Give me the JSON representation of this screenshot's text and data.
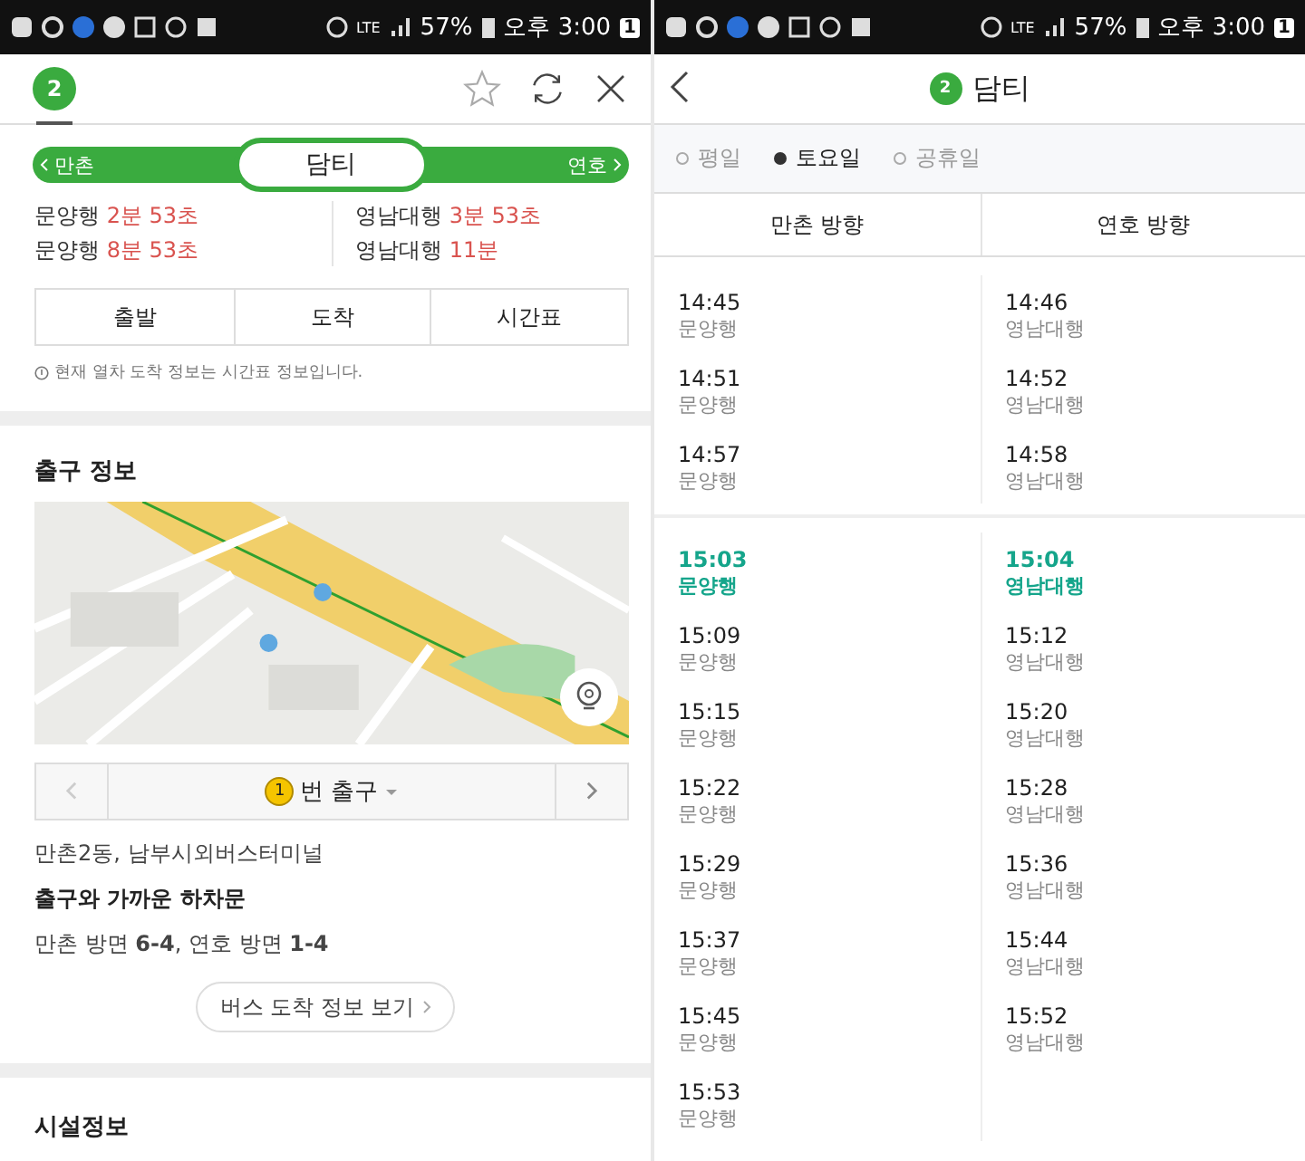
{
  "status_bars": [
    {
      "network": "LTE",
      "battery": "57%",
      "time": "오후 3:00",
      "notification_count": "1"
    },
    {
      "network": "LTE",
      "battery": "57%",
      "time": "오후 3:00",
      "notification_count": "1"
    }
  ],
  "station_panel": {
    "line_badge": "2",
    "station_bar": {
      "previous": "만촌",
      "current": "담티",
      "next": "연호"
    },
    "arrivals": [
      [
        {
          "destination": "문양행",
          "time": "2분 53초"
        },
        {
          "destination": "문양행",
          "time": "8분 53초"
        }
      ],
      [
        {
          "destination": "영남대행",
          "time": "3분 53초"
        },
        {
          "destination": "영남대행",
          "time": "11분"
        }
      ]
    ],
    "buttons": [
      "출발",
      "도착",
      "시간표"
    ],
    "notice": "현재 열차 도착 정보는 시간표 정보입니다.",
    "exit_info": {
      "title": "출구 정보",
      "exit_number": "1",
      "exit_label": "번 출구",
      "address": "만촌2동, 남부시외버스터미널",
      "nearest_door_title": "출구와 가까운 하차문",
      "nearest_door": "만촌 방면 **6-4**, 연호 방면 **1-4**",
      "bus_button": "버스 도착 정보 보기"
    },
    "facility_title": "시설정보"
  },
  "timetable_panel": {
    "line_badge": "2",
    "title": "담티",
    "day_tabs": [
      {
        "label": "평일",
        "selected": false
      },
      {
        "label": "토요일",
        "selected": true
      },
      {
        "label": "공휴일",
        "selected": false
      }
    ],
    "columns": [
      "만촌 방향",
      "연호 방향"
    ],
    "earlier_rows": [
      [
        {
          "time": "14:45",
          "destination": "문양행",
          "highlighted": false
        },
        {
          "time": "14:46",
          "destination": "영남대행",
          "highlighted": false
        }
      ],
      [
        {
          "time": "14:51",
          "destination": "문양행",
          "highlighted": false
        },
        {
          "time": "14:52",
          "destination": "영남대행",
          "highlighted": false
        }
      ],
      [
        {
          "time": "14:57",
          "destination": "문양행",
          "highlighted": false
        },
        {
          "time": "14:58",
          "destination": "영남대행",
          "highlighted": false
        }
      ]
    ],
    "later_rows": [
      [
        {
          "time": "15:03",
          "destination": "문양행",
          "highlighted": true
        },
        {
          "time": "15:04",
          "destination": "영남대행",
          "highlighted": true
        }
      ],
      [
        {
          "time": "15:09",
          "destination": "문양행",
          "highlighted": false
        },
        {
          "time": "15:12",
          "destination": "영남대행",
          "highlighted": false
        }
      ],
      [
        {
          "time": "15:15",
          "destination": "문양행",
          "highlighted": false
        },
        {
          "time": "15:20",
          "destination": "영남대행",
          "highlighted": false
        }
      ],
      [
        {
          "time": "15:22",
          "destination": "문양행",
          "highlighted": false
        },
        {
          "time": "15:28",
          "destination": "영남대행",
          "highlighted": false
        }
      ],
      [
        {
          "time": "15:29",
          "destination": "문양행",
          "highlighted": false
        },
        {
          "time": "15:36",
          "destination": "영남대행",
          "highlighted": false
        }
      ],
      [
        {
          "time": "15:37",
          "destination": "문양행",
          "highlighted": false
        },
        {
          "time": "15:44",
          "destination": "영남대행",
          "highlighted": false
        }
      ],
      [
        {
          "time": "15:45",
          "destination": "문양행",
          "highlighted": false
        },
        {
          "time": "15:52",
          "destination": "영남대행",
          "highlighted": false
        }
      ],
      [
        {
          "time": "15:53",
          "destination": "문양행",
          "highlighted": false
        },
        null
      ]
    ]
  }
}
